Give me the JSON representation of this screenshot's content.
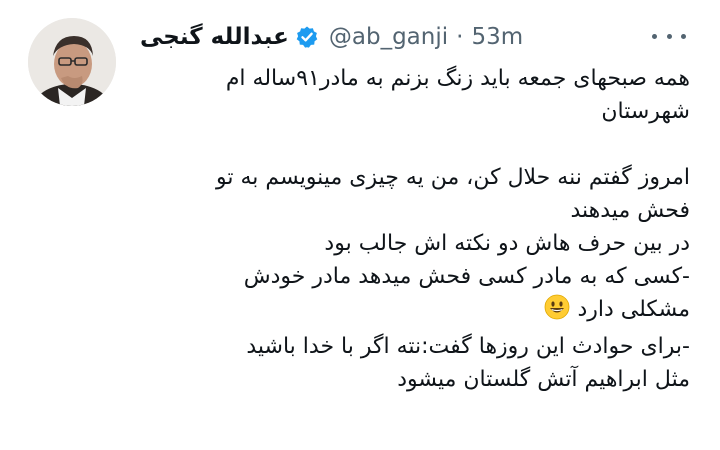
{
  "author": {
    "display_name": "عبدالله گنجی",
    "handle": "@ab_ganji",
    "separator": "·",
    "time": "53m",
    "verified_icon": "verified-badge-icon",
    "verified_color": "#1d9bf0"
  },
  "more_icon": "more-dots-icon",
  "tweet": {
    "lines": [
      "همه صبحهای جمعه باید زنگ بزنم به مادر۹۱ساله ام",
      "شهرستان",
      "",
      "امروز گفتم ننه حلال کن، من یه چیزی مینویسم به تو",
      "فحش میدهند",
      "در بین حرف هاش دو نکته اش جالب بود",
      "-کسی که به مادر کسی فحش میدهد مادر خودش",
      "مشکلی دارد",
      "-برای حوادث این روزها گفت:نته اگر با خدا باشید",
      "مثل ابراهیم آتش گلستان میشود"
    ],
    "emoji": "grinning-face-emoji"
  },
  "colors": {
    "text": "#0f1419",
    "secondary": "#536471"
  }
}
